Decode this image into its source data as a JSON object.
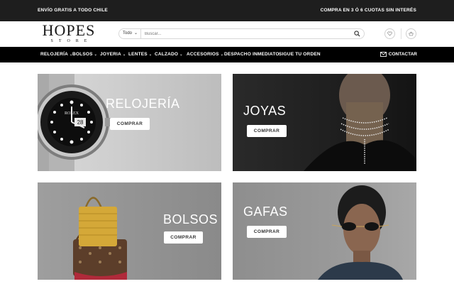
{
  "topbar": {
    "left_text": "ENVÍO GRATIS A TODO CHILE",
    "right_text": "COMPRA EN 3 Ó 6 CUOTAS SIN INTERÉS"
  },
  "logo": {
    "line1": "HOPES",
    "line2": "STORE"
  },
  "search": {
    "category": "Todo",
    "placeholder": "Buscar..."
  },
  "nav": {
    "items": [
      {
        "label": "RELOJERÍA"
      },
      {
        "label": "BOLSOS"
      },
      {
        "label": "JOYERIA"
      },
      {
        "label": "LENTES"
      },
      {
        "label": "CALZADO"
      },
      {
        "label": "ACCESORIOS"
      },
      {
        "label": "DESPACHO INMEDIATO"
      },
      {
        "label": "SIGUE TU ORDEN"
      }
    ],
    "contact": "CONTACTAR"
  },
  "tiles": [
    {
      "title": "RELOJERÍA",
      "button": "COMPRAR"
    },
    {
      "title": "JOYAS",
      "button": "COMPRAR"
    },
    {
      "title": "BOLSOS",
      "button": "COMPRAR"
    },
    {
      "title": "GAFAS",
      "button": "COMPRAR"
    }
  ],
  "product_marks": {
    "watch_brand": "ROLEX",
    "watch_date": "28"
  },
  "colors": {
    "topbar_bg": "#1e1e1e",
    "nav_bg": "#000000",
    "button_bg": "#ffffff"
  }
}
